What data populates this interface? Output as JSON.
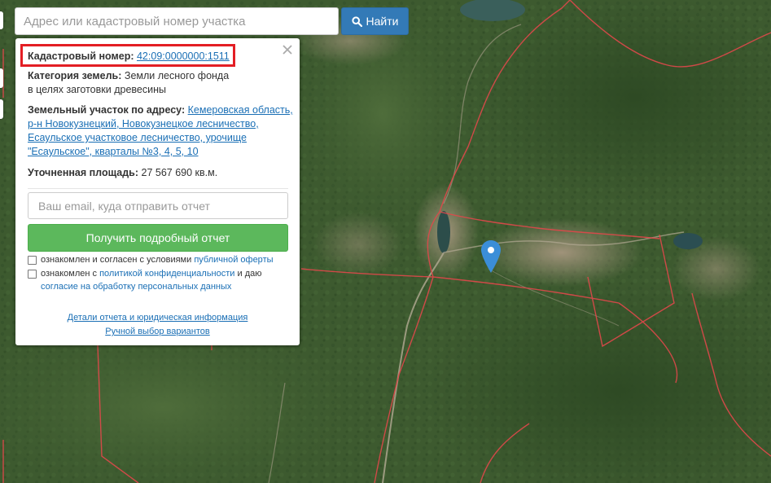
{
  "search": {
    "placeholder": "Адрес или кадастровый номер участка",
    "button_label": "Найти",
    "button_icon": "search-icon"
  },
  "panel": {
    "close_icon": "close-icon",
    "cadastral": {
      "label": "Кадастровый номер:",
      "value": "42:09:0000000:1511",
      "highlight_color": "#e31e24"
    },
    "category": {
      "label": "Категория земель:",
      "value_line1": "Земли лесного фонда",
      "value_line2": "в целях заготовки древесины"
    },
    "address": {
      "label": "Земельный участок по адресу:",
      "line1": "Кемеровская область,",
      "line2": "р-н Новокузнецкий, Новокузнецкое лесничество,",
      "line3": "Есаульское участковое лесничество, урочище",
      "line4": "\"Есаульское\", кварталы №3, 4, 5, 10"
    },
    "area": {
      "label": "Уточненная площадь:",
      "value": "27 567 690 кв.м."
    },
    "email_placeholder": "Ваш email, куда отправить отчет",
    "report_button": "Получить подробный отчет",
    "agree_offer": {
      "text": "ознакомлен и согласен с условиями",
      "link": "публичной оферты",
      "checked": false
    },
    "agree_privacy": {
      "text_before": "ознакомлен с",
      "link1": "политикой конфиденциальности",
      "text_mid": "и даю",
      "link2": "согласие на обработку персональных данных",
      "checked": false
    },
    "footer_link1": "Детали отчета и юридическая информация",
    "footer_link2": "Ручной выбор вариантов"
  },
  "map": {
    "marker_icon": "map-pin-icon",
    "marker_color": "#3b8ed8",
    "boundary_color": "#e0484b"
  },
  "colors": {
    "primary": "#337ab7",
    "success": "#5cb85c",
    "link": "#1a6fb5"
  }
}
